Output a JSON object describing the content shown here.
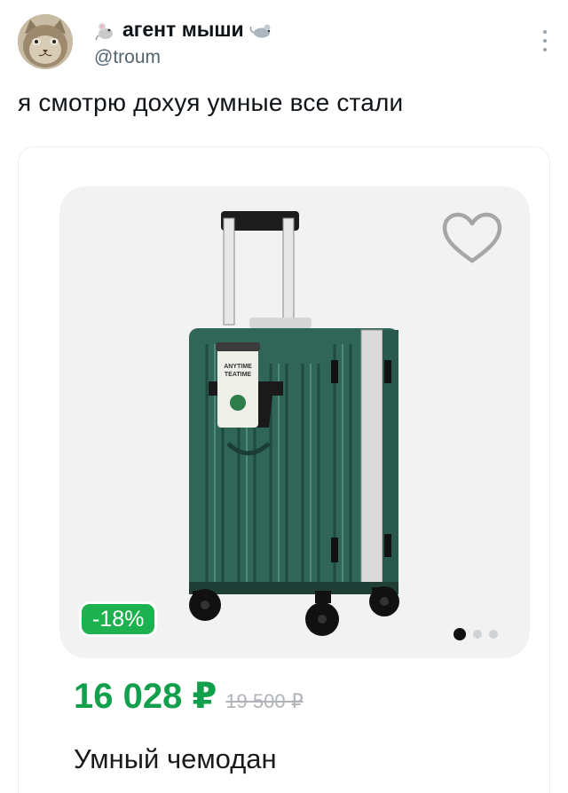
{
  "author": {
    "name": "агент мыши",
    "handle": "@troum"
  },
  "tweet": {
    "text": "я смотрю дохуя умные все стали"
  },
  "product": {
    "discount": "-18%",
    "price_current": "16 028 ₽",
    "price_old": "19 500 ₽",
    "name": "Умный чемодан",
    "cup_text": "ANYTIME TEATIME",
    "image_count": 3,
    "image_active_index": 1
  },
  "icons": {
    "leading": "mouse-icon",
    "trailing": "rat-icon",
    "more": "more-vertical-icon",
    "favorite": "heart-outline-icon"
  },
  "colors": {
    "price": "#12a04c",
    "discount_bg": "#1db14f",
    "suitcase": "#2f6657"
  }
}
